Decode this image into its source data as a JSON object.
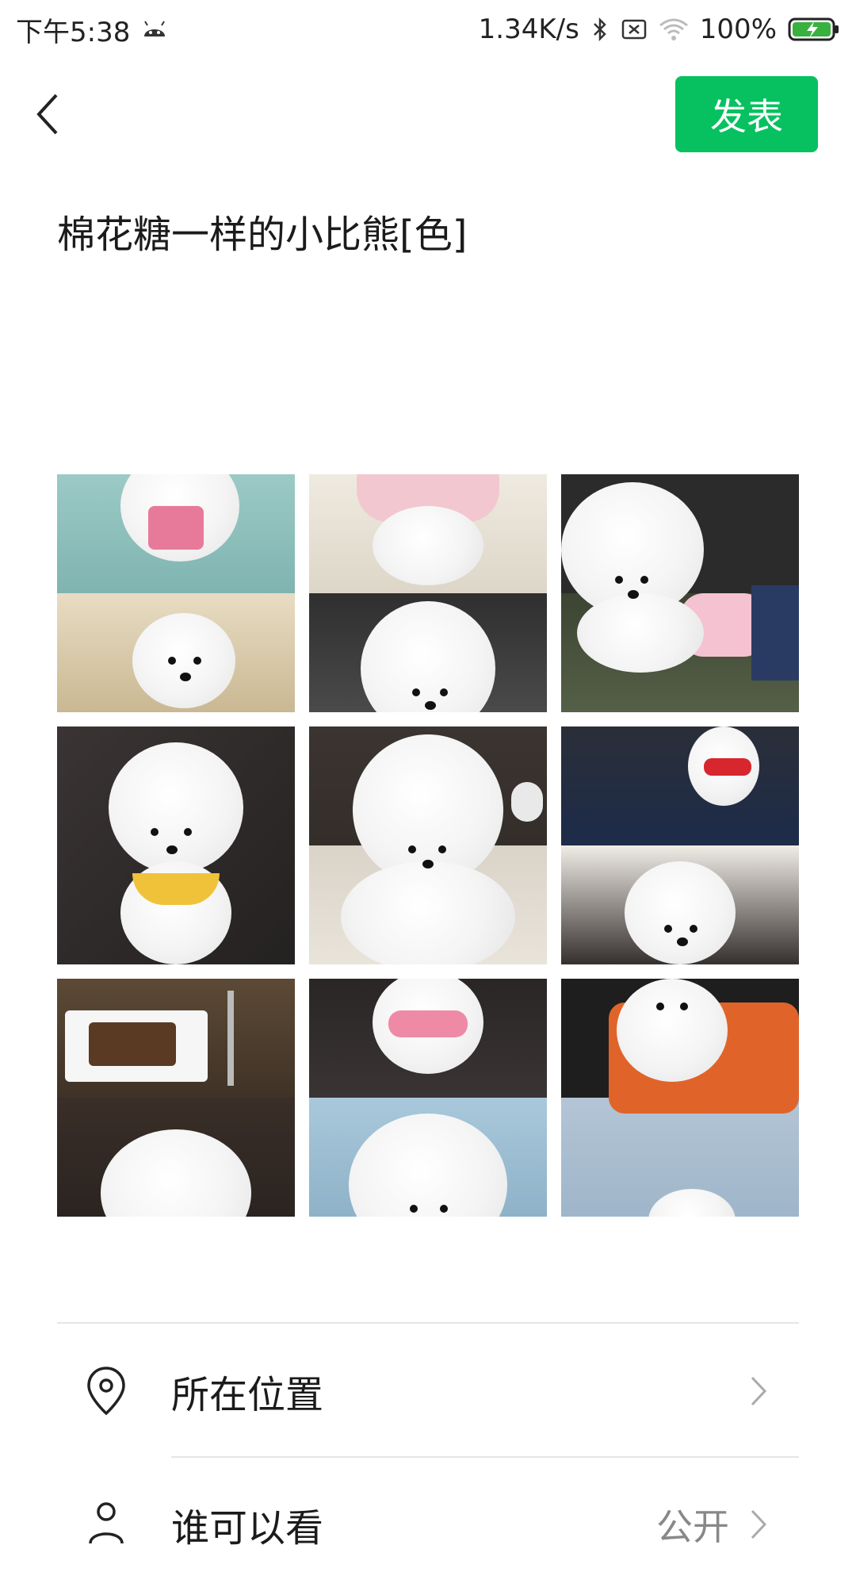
{
  "status_bar": {
    "time": "下午5:38",
    "net_speed": "1.34K/s",
    "battery": "100%"
  },
  "header": {
    "back_icon": "chevron-left-icon",
    "post_label": "发表",
    "accent": "#07c160"
  },
  "post": {
    "text": "棉花糖一样的小比熊[色]"
  },
  "photos": [
    {
      "name": "photo-1",
      "top": "#8fc3bf",
      "bottom": "#d9c9a8"
    },
    {
      "name": "photo-2",
      "top": "#e8e3d8",
      "bottom": "#3b3b3b"
    },
    {
      "name": "photo-3",
      "top": "#2a2a2a",
      "bottom": "#4b5542"
    },
    {
      "name": "photo-4",
      "top": "#2e2b2a",
      "bottom": "#3a3636"
    },
    {
      "name": "photo-5",
      "top": "#3a3430",
      "bottom": "#d7d2c8"
    },
    {
      "name": "photo-6",
      "top": "#2b2f3a",
      "bottom": "#3a3432"
    },
    {
      "name": "photo-7",
      "top": "#5a4a38",
      "bottom": "#3a2e26"
    },
    {
      "name": "photo-8",
      "top": "#2a2626",
      "bottom": "#9ec0d6"
    },
    {
      "name": "photo-9",
      "top": "#1e1e1e",
      "bottom": "#a9bdd0"
    }
  ],
  "list": {
    "location_label": "所在位置",
    "visibility_label": "谁可以看",
    "visibility_value": "公开"
  }
}
